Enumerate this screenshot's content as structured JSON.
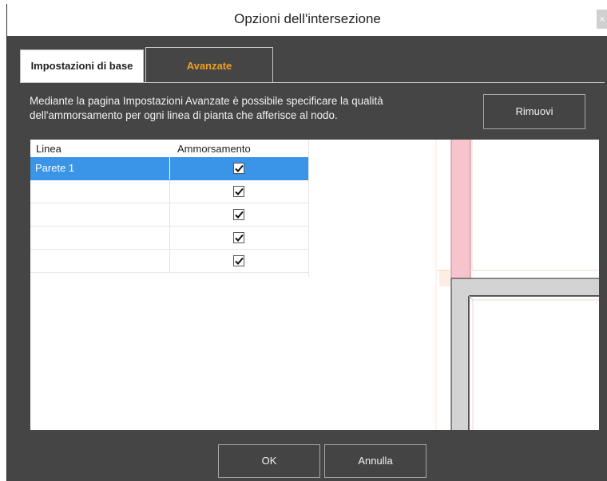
{
  "window": {
    "title": "Opzioni dell'intersezione",
    "close_glyph": "×"
  },
  "tabs": [
    {
      "label": "Impostazioni di base",
      "active": false
    },
    {
      "label": "Avanzate",
      "active": true
    }
  ],
  "description": {
    "line1": "Mediante la pagina Impostazioni Avanzate è possibile specificare  la qualità",
    "line2": "dell'ammorsamento per ogni linea di pianta che afferisce al nodo."
  },
  "buttons": {
    "remove": "Rimuovi",
    "ok": "OK",
    "cancel": "Annulla"
  },
  "table": {
    "columns": [
      "Linea",
      "Ammorsamento"
    ],
    "rows": [
      {
        "linea": "Parete 1",
        "ammorsamento": true,
        "selected": true
      },
      {
        "linea": "",
        "ammorsamento": true,
        "selected": false
      },
      {
        "linea": "",
        "ammorsamento": true,
        "selected": false
      },
      {
        "linea": "",
        "ammorsamento": true,
        "selected": false
      },
      {
        "linea": "",
        "ammorsamento": true,
        "selected": false
      }
    ]
  },
  "colors": {
    "dialog_bg": "#454545",
    "accent_tab": "#f0a020",
    "selection": "#3a94e8",
    "preview_wall_pink": "#f7c3cc",
    "preview_wall_gray": "#d3d3d3"
  },
  "icons": {
    "close": "close-icon",
    "check": "checkmark-icon"
  }
}
